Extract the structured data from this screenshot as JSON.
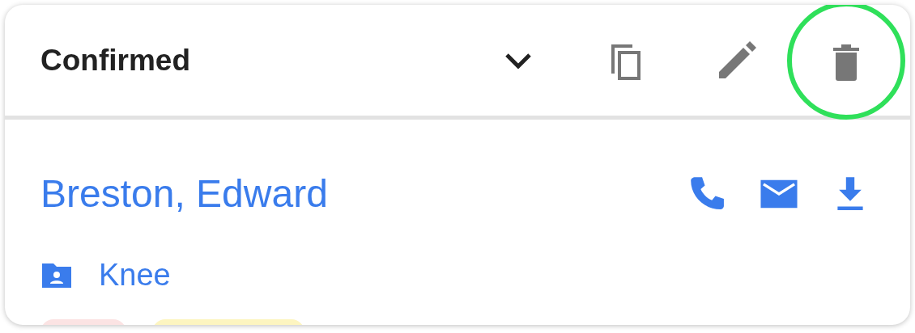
{
  "header": {
    "status": "Confirmed",
    "actions": [
      {
        "kind": "expand",
        "highlighted": false
      },
      {
        "kind": "copy",
        "highlighted": false
      },
      {
        "kind": "edit",
        "highlighted": false
      },
      {
        "kind": "delete",
        "highlighted": true
      }
    ]
  },
  "patient": {
    "name": "Breston, Edward",
    "contacts": [
      {
        "kind": "phone"
      },
      {
        "kind": "email"
      },
      {
        "kind": "download"
      }
    ],
    "folder": "Knee"
  },
  "tags": [
    {
      "color": "#fbe3e3"
    },
    {
      "color": "#fdf5c0"
    }
  ]
}
